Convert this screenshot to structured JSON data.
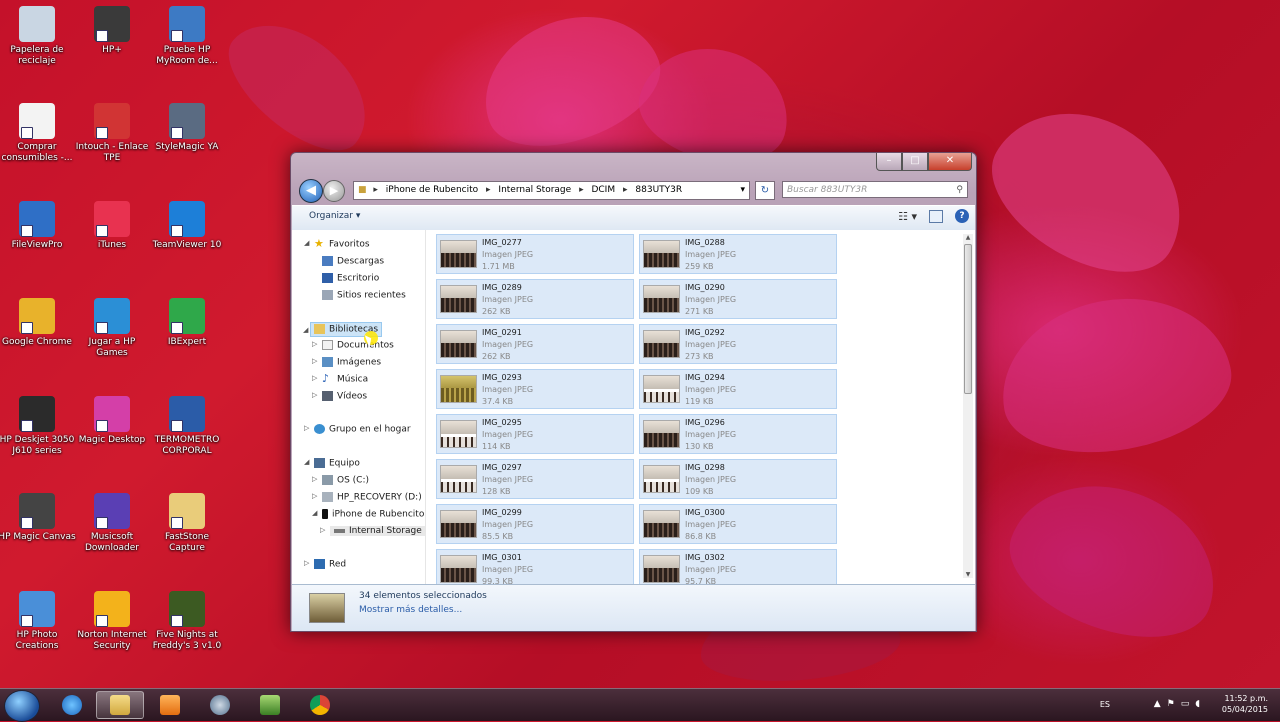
{
  "desktop": {
    "icons": [
      {
        "label": "Papelera de reciclaje",
        "icon": "recycle-bin-icon",
        "color": "#c9d6e3"
      },
      {
        "label": "HP+",
        "icon": "hp-logo-icon",
        "color": "#3a3a3a"
      },
      {
        "label": "Pruebe HP MyRoom de...",
        "icon": "users-icon",
        "color": "#3d7ac4"
      },
      {
        "label": "Comprar consumibles -...",
        "icon": "printer-icon",
        "color": "#f3f3f3"
      },
      {
        "label": "Intouch - Enlace TPE",
        "icon": "intouch-icon",
        "color": "#d13434"
      },
      {
        "label": "StyleMagic YA",
        "icon": "keyboard-icon",
        "color": "#5a6b82"
      },
      {
        "label": "FileViewPro",
        "icon": "magnifier-icon",
        "color": "#2f6fc6"
      },
      {
        "label": "iTunes",
        "icon": "music-note-icon",
        "color": "#e83250"
      },
      {
        "label": "TeamViewer 10",
        "icon": "teamviewer-icon",
        "color": "#1d7fd8"
      },
      {
        "label": "Google Chrome",
        "icon": "chrome-icon",
        "color": "#e8b22b"
      },
      {
        "label": "Jugar a HP Games",
        "icon": "games-icon",
        "color": "#2b8fd6"
      },
      {
        "label": "IBExpert",
        "icon": "database-icon",
        "color": "#2fa84a"
      },
      {
        "label": "HP Deskjet 3050 J610 series",
        "icon": "printer-icon",
        "color": "#2b2b2b"
      },
      {
        "label": "Magic Desktop",
        "icon": "magic-desktop-icon",
        "color": "#d43fa8"
      },
      {
        "label": "TERMOMETRO CORPORAL",
        "icon": "word-document-icon",
        "color": "#2b5ca8"
      },
      {
        "label": "HP Magic Canvas",
        "icon": "house-icon",
        "color": "#444444"
      },
      {
        "label": "Musicsoft Downloader",
        "icon": "musicsoft-icon",
        "color": "#5a3fb4"
      },
      {
        "label": "FastStone Capture",
        "icon": "folder-icon",
        "color": "#e9cc7a"
      },
      {
        "label": "HP Photo Creations",
        "icon": "photo-icon",
        "color": "#4a8fd8"
      },
      {
        "label": "Norton Internet Security",
        "icon": "globe-icon",
        "color": "#f3b21b"
      },
      {
        "label": "Five Nights at Freddy's 3 v1.0",
        "icon": "game-icon",
        "color": "#3c5a22"
      }
    ]
  },
  "window": {
    "address": [
      "iPhone de Rubencito",
      "Internal Storage",
      "DCIM",
      "883UTY3R"
    ],
    "search_placeholder": "Buscar 883UTY3R",
    "toolbar": {
      "organize": "Organizar ▾"
    },
    "nav": {
      "favorites": {
        "label": "Favoritos",
        "items": [
          "Descargas",
          "Escritorio",
          "Sitios recientes"
        ]
      },
      "libraries": {
        "label": "Bibliotecas",
        "items": [
          "Documentos",
          "Imágenes",
          "Música",
          "Vídeos"
        ]
      },
      "homegroup": "Grupo en el hogar",
      "computer": {
        "label": "Equipo",
        "items": [
          "OS (C:)",
          "HP_RECOVERY (D:)",
          "iPhone de Rubencito",
          "Internal Storage"
        ]
      },
      "network": "Red"
    },
    "files": [
      {
        "name": "IMG_0277",
        "type": "Imagen JPEG",
        "size": "1.71 MB",
        "style": "a"
      },
      {
        "name": "IMG_0288",
        "type": "Imagen JPEG",
        "size": "259 KB",
        "style": "a"
      },
      {
        "name": "IMG_0289",
        "type": "Imagen JPEG",
        "size": "262 KB",
        "style": "a"
      },
      {
        "name": "IMG_0290",
        "type": "Imagen JPEG",
        "size": "271 KB",
        "style": "a"
      },
      {
        "name": "IMG_0291",
        "type": "Imagen JPEG",
        "size": "262 KB",
        "style": "a"
      },
      {
        "name": "IMG_0292",
        "type": "Imagen JPEG",
        "size": "273 KB",
        "style": "a"
      },
      {
        "name": "IMG_0293",
        "type": "Imagen JPEG",
        "size": "37.4 KB",
        "style": "gold"
      },
      {
        "name": "IMG_0294",
        "type": "Imagen JPEG",
        "size": "119 KB",
        "style": "sparse"
      },
      {
        "name": "IMG_0295",
        "type": "Imagen JPEG",
        "size": "114 KB",
        "style": "sparse"
      },
      {
        "name": "IMG_0296",
        "type": "Imagen JPEG",
        "size": "130 KB",
        "style": "a"
      },
      {
        "name": "IMG_0297",
        "type": "Imagen JPEG",
        "size": "128 KB",
        "style": "sparse"
      },
      {
        "name": "IMG_0298",
        "type": "Imagen JPEG",
        "size": "109 KB",
        "style": "sparse"
      },
      {
        "name": "IMG_0299",
        "type": "Imagen JPEG",
        "size": "85.5 KB",
        "style": "a"
      },
      {
        "name": "IMG_0300",
        "type": "Imagen JPEG",
        "size": "86.8 KB",
        "style": "a"
      },
      {
        "name": "IMG_0301",
        "type": "Imagen JPEG",
        "size": "99.3 KB",
        "style": "a"
      },
      {
        "name": "IMG_0302",
        "type": "Imagen JPEG",
        "size": "95.7 KB",
        "style": "a"
      }
    ],
    "details": {
      "count": "34 elementos seleccionados",
      "more": "Mostrar más detalles..."
    }
  },
  "taskbar": {
    "apps": [
      "internet-explorer-icon",
      "file-explorer-icon",
      "media-player-icon",
      "network-icon",
      "photo-viewer-icon",
      "chrome-icon"
    ],
    "language": "ES",
    "time": "11:52 p.m.",
    "date": "05/04/2015"
  },
  "colors": {
    "selection": "#dce9f8",
    "selection_border": "#b5d2f1",
    "link": "#2a5ca8"
  }
}
